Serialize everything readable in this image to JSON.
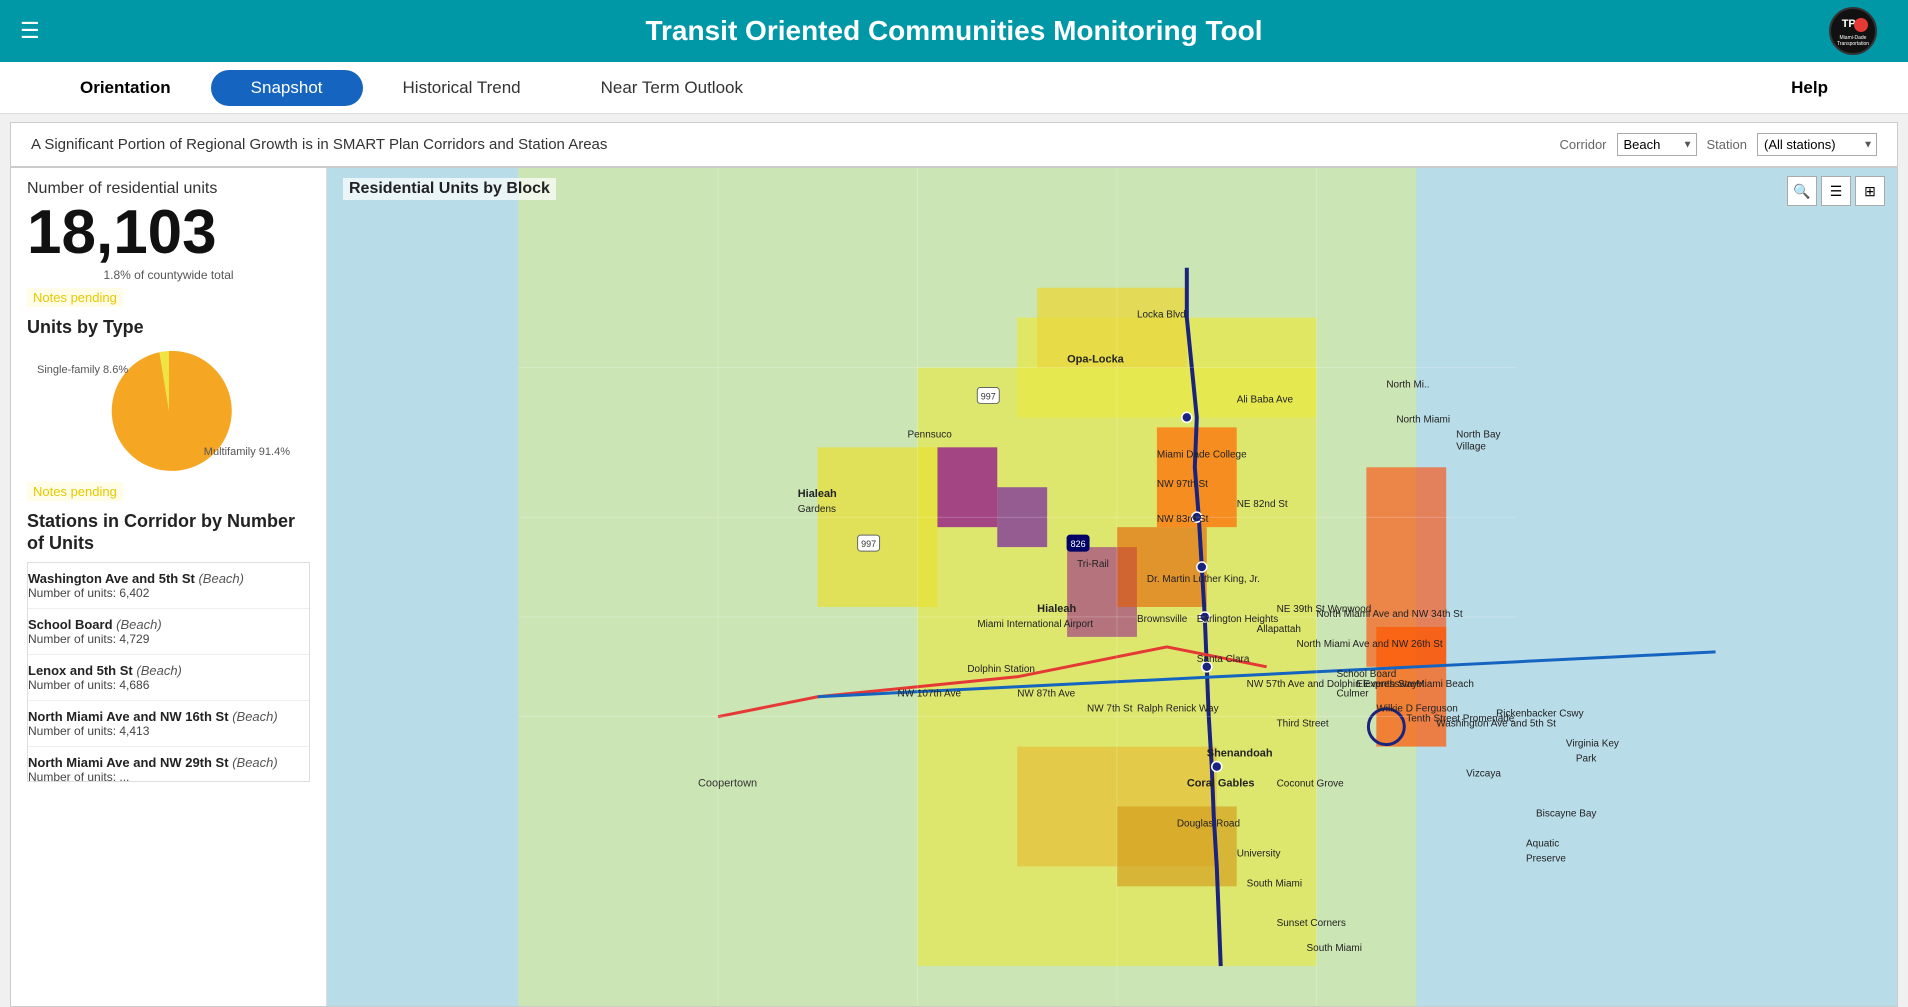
{
  "header": {
    "title": "Transit Oriented Communities Monitoring Tool",
    "menu_icon": "☰",
    "logo_text": "TPO",
    "logo_subtitle": "Miami-Dade Transportation\nPlanning Organization"
  },
  "nav": {
    "items": [
      {
        "id": "orientation",
        "label": "Orientation",
        "active": false,
        "bold": true
      },
      {
        "id": "snapshot",
        "label": "Snapshot",
        "active": true,
        "bold": false
      },
      {
        "id": "historical-trend",
        "label": "Historical Trend",
        "active": false,
        "bold": false
      },
      {
        "id": "near-term-outlook",
        "label": "Near Term Outlook",
        "active": false,
        "bold": false
      },
      {
        "id": "help",
        "label": "Help",
        "active": false,
        "bold": true
      }
    ]
  },
  "subtitle": {
    "text": "A Significant Portion of Regional Growth is in SMART Plan Corridors and Station Areas",
    "corridor_label": "Corridor",
    "corridor_value": "Beach",
    "station_label": "Station",
    "station_value": "(All stations)"
  },
  "left_panel": {
    "units_label": "Number of residential units",
    "units_count": "18,103",
    "units_percent": "1.8% of countywide total",
    "notes_pending_1": "Notes pending",
    "units_by_type_label": "Units by Type",
    "pie": {
      "single_family_pct": 8.6,
      "multifamily_pct": 91.4,
      "single_family_label": "Single-family 8.6%",
      "multifamily_label": "Multifamily 91.4%",
      "single_family_color": "#f0e442",
      "multifamily_color": "#f5a623"
    },
    "notes_pending_2": "Notes pending",
    "stations_label": "Stations in Corridor by Number of Units",
    "stations": [
      {
        "name": "Washington Ave and 5th St",
        "corridor": "Beach",
        "units": "6,402"
      },
      {
        "name": "School Board",
        "corridor": "Beach",
        "units": "4,729"
      },
      {
        "name": "Lenox and 5th St",
        "corridor": "Beach",
        "units": "4,686"
      },
      {
        "name": "North Miami Ave and NW 16th St",
        "corridor": "Beach",
        "units": "4,413"
      },
      {
        "name": "North Miami Ave and NW 29th St",
        "corridor": "Beach",
        "units": "..."
      }
    ]
  },
  "map": {
    "title": "Residential Units by Block",
    "toolbar": {
      "search_icon": "🔍",
      "list_icon": "☰",
      "grid_icon": "⊞"
    }
  }
}
